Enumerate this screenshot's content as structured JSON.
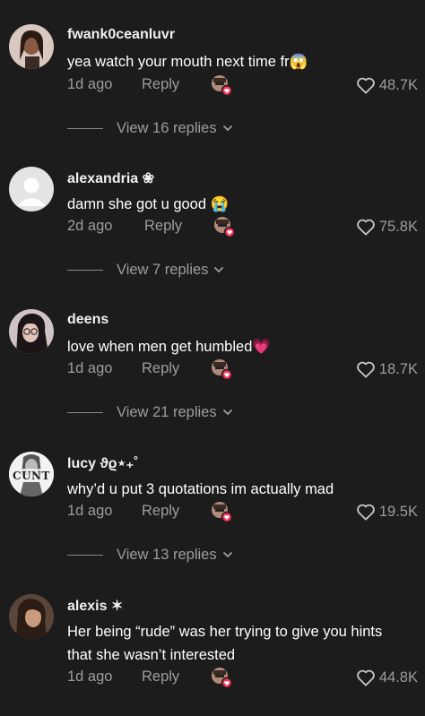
{
  "comments": [
    {
      "username": "fwank0ceanluvr",
      "text": "yea watch your mouth next time fr😱",
      "time": "1d ago",
      "reply_label": "Reply",
      "likes": "48.7K",
      "view_replies": "View 16 replies"
    },
    {
      "username": "alexandria ❀",
      "text": "damn she got u good 😭",
      "time": "2d ago",
      "reply_label": "Reply",
      "likes": "75.8K",
      "view_replies": "View 7 replies"
    },
    {
      "username": "deens",
      "text": "love when men get humbled💗",
      "time": "1d ago",
      "reply_label": "Reply",
      "likes": "18.7K",
      "view_replies": "View 21 replies"
    },
    {
      "username": "lucy ϑϱ⋆₊˚",
      "text": "why’d u put 3 quotations im actually mad",
      "time": "1d ago",
      "reply_label": "Reply",
      "likes": "19.5K",
      "view_replies": "View 13 replies"
    },
    {
      "username": "alexis ✶",
      "text": "Her being “rude” was her trying to give you hints that she wasn’t interested",
      "time": "1d ago",
      "reply_label": "Reply",
      "likes": "44.8K",
      "view_replies": ""
    }
  ],
  "avatar_4_text": "CUNT",
  "colors": {
    "background": "#1c1c1c",
    "primary_text": "#ffffff",
    "secondary_text": "#9d9d9d",
    "creator_liked_badge": "#fe2c55"
  },
  "icons": {
    "like": "heart-outline-icon",
    "view_replies": "chevron-down-icon",
    "creator_liked": "creator-liked-badge-icon"
  }
}
